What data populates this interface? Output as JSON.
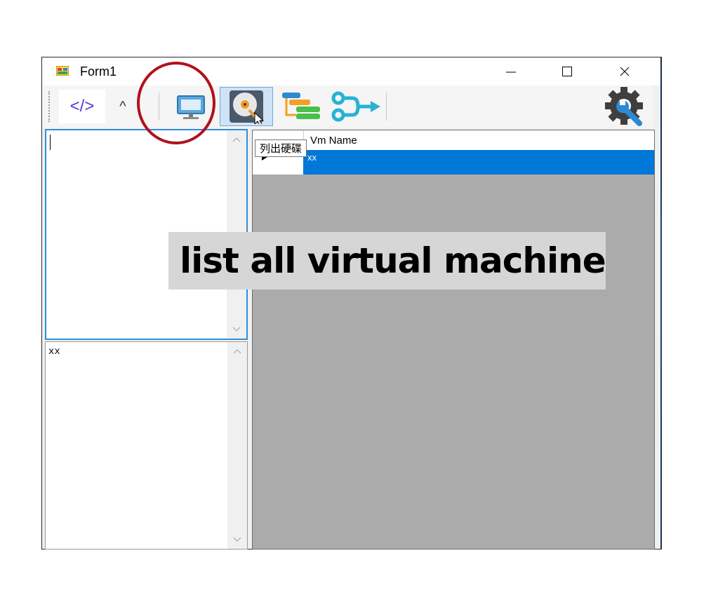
{
  "window": {
    "title": "Form1",
    "minimize_label": "—",
    "maximize_label": "☐",
    "close_label": "✕"
  },
  "toolbar": {
    "code_label": "</>",
    "chevron_label": "^",
    "items": [
      "code-button",
      "chevron-button",
      "monitor-button",
      "list-disks-button",
      "tree-button",
      "flow-button",
      "settings-button"
    ]
  },
  "left_top_panel": {
    "text": ""
  },
  "left_bottom_panel": {
    "text": "xx"
  },
  "grid": {
    "column_header": "Vm Name",
    "rows": [
      {
        "selected": true,
        "value": "xx"
      }
    ]
  },
  "tooltip": {
    "text": "列出硬碟"
  },
  "caption": {
    "text": "list all virtual machine"
  },
  "colors": {
    "selection": "#0078d7",
    "grid_bg": "#ababab",
    "callout": "#b0121b"
  }
}
